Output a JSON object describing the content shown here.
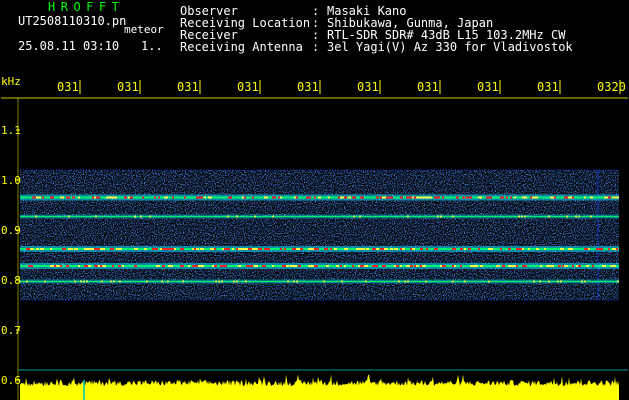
{
  "header": {
    "app_title": "HROFFT",
    "file_name": "UT2508110310.pn",
    "file_suffix": "meteor",
    "date_time": "25.08.11 03:10",
    "counter": "1..",
    "meta": [
      {
        "label": "Observer",
        "sep": ":",
        "value": "Masaki Kano"
      },
      {
        "label": "Receiving Location",
        "sep": ":",
        "value": "Shibukawa, Gunma, Japan"
      },
      {
        "label": "Receiver",
        "sep": ":",
        "value": "RTL-SDR SDR# 43dB L15 103.2MHz CW"
      },
      {
        "label": "Receiving Antenna",
        "sep": ":",
        "value": "3el Yagi(V) Az 330 for Vladivostok"
      }
    ]
  },
  "chart_data": {
    "type": "heatmap",
    "ylabel": "kHz",
    "x_ticks": [
      "031",
      "031",
      "031",
      "031",
      "031",
      "031",
      "031",
      "031",
      "031",
      "0320"
    ],
    "y_ticks": [
      "1.1",
      "1.0",
      "0.9",
      "0.8",
      "0.7",
      "0.6"
    ],
    "ylim": [
      0.6,
      1.15
    ],
    "band_range_khz": [
      0.76,
      1.02
    ],
    "signal_lines_khz": [
      {
        "freq": 0.965,
        "strength": "strong"
      },
      {
        "freq": 0.927,
        "strength": "medium"
      },
      {
        "freq": 0.862,
        "strength": "strong"
      },
      {
        "freq": 0.828,
        "strength": "strong"
      },
      {
        "freq": 0.797,
        "strength": "medium"
      }
    ],
    "colors": {
      "background": "#000000",
      "noise": "#1a3cff",
      "signal_mid": "#00e0ff",
      "signal_high": "#00ff66",
      "signal_peak": "#ff2020",
      "axis": "#ffff00",
      "level_bar": "#ffff00",
      "marker": "#00c0c0"
    }
  }
}
